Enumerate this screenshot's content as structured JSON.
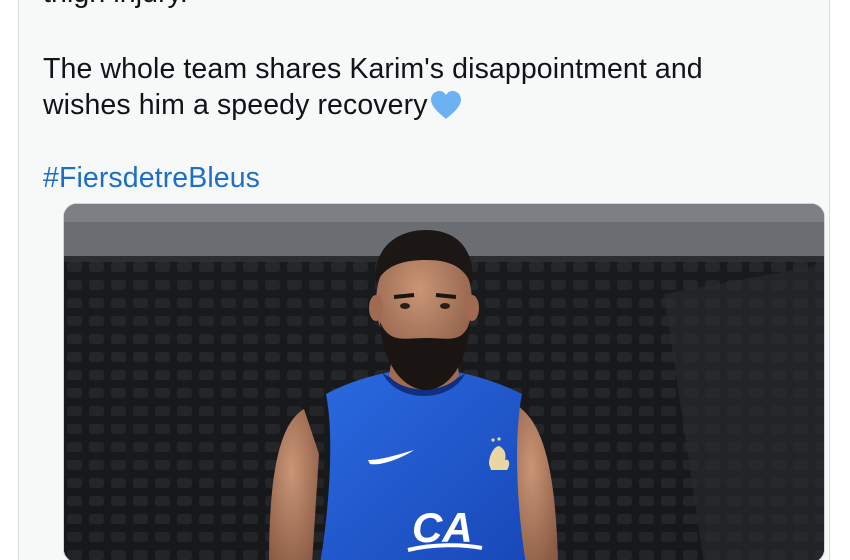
{
  "tweet": {
    "line_partial": "thigh injury.",
    "line_1": "The whole team shares Karim's disappointment and",
    "line_2": "wishes him a speedy recovery",
    "emoji": "blue-heart",
    "hashtag": "#FiersdetreBleus"
  },
  "media": {
    "alt": "Photo of a player in a blue France training shirt in a stadium",
    "jersey_color": "#1f5fd6",
    "jersey_sponsor": "CA"
  },
  "colors": {
    "card_bg": "#f7f9f9",
    "text": "#0f1419",
    "hashtag": "#1d6fc6",
    "heart": "#6cb1f2"
  }
}
